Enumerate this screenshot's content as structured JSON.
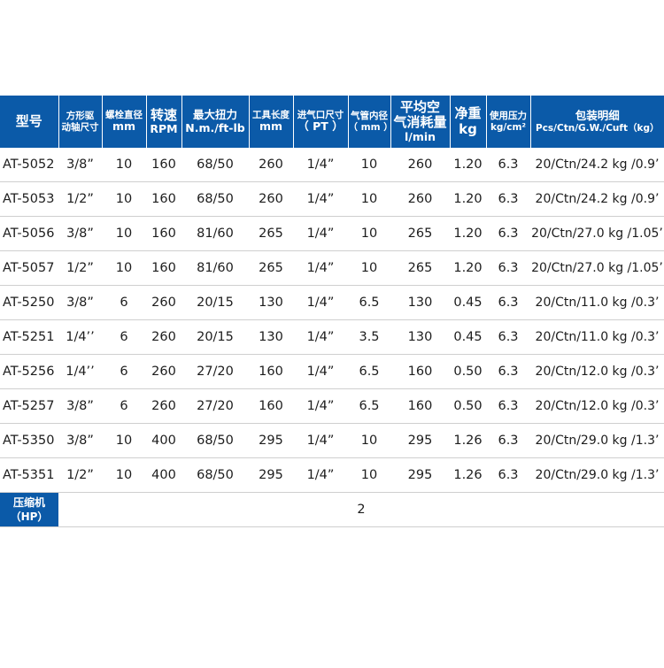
{
  "table": {
    "headers": [
      {
        "line1": "型号",
        "line2": ""
      },
      {
        "line1": "方形驱",
        "line2": "动轴尺寸"
      },
      {
        "line1": "螺栓直径",
        "line2": "mm"
      },
      {
        "line1": "转速",
        "line2": "RPM"
      },
      {
        "line1": "最大扭力",
        "line2": "N.m./ft-lb"
      },
      {
        "line1": "工具长度",
        "line2": "mm"
      },
      {
        "line1": "进气口尺寸",
        "line2": "（ PT ）"
      },
      {
        "line1": "气管内径",
        "line2": "（ mm ）"
      },
      {
        "line1": "平均空",
        "line2": "气消耗量",
        "line3": "l/min"
      },
      {
        "line1": "净重",
        "line2": "kg"
      },
      {
        "line1": "使用压力",
        "line2": "kg/cm²"
      },
      {
        "line1": "包装明细",
        "line2": "Pcs/Ctn/G.W./Cuft（kg）"
      }
    ],
    "rows": [
      [
        "AT-5052",
        "3/8”",
        "10",
        "160",
        "68/50",
        "260",
        "1/4”",
        "10",
        "260",
        "1.20",
        "6.3",
        "20/Ctn/24.2 kg /0.9’"
      ],
      [
        "AT-5053",
        "1/2”",
        "10",
        "160",
        "68/50",
        "260",
        "1/4”",
        "10",
        "260",
        "1.20",
        "6.3",
        "20/Ctn/24.2 kg /0.9’"
      ],
      [
        "AT-5056",
        "3/8”",
        "10",
        "160",
        "81/60",
        "265",
        "1/4”",
        "10",
        "265",
        "1.20",
        "6.3",
        "20/Ctn/27.0 kg /1.05’"
      ],
      [
        "AT-5057",
        "1/2”",
        "10",
        "160",
        "81/60",
        "265",
        "1/4”",
        "10",
        "265",
        "1.20",
        "6.3",
        "20/Ctn/27.0 kg /1.05’"
      ],
      [
        "AT-5250",
        "3/8”",
        "6",
        "260",
        "20/15",
        "130",
        "1/4”",
        "6.5",
        "130",
        "0.45",
        "6.3",
        "20/Ctn/11.0 kg /0.3’"
      ],
      [
        "AT-5251",
        "1/4’’",
        "6",
        "260",
        "20/15",
        "130",
        "1/4”",
        "3.5",
        "130",
        "0.45",
        "6.3",
        "20/Ctn/11.0 kg /0.3’"
      ],
      [
        "AT-5256",
        "1/4’’",
        "6",
        "260",
        "27/20",
        "160",
        "1/4”",
        "6.5",
        "160",
        "0.50",
        "6.3",
        "20/Ctn/12.0 kg /0.3’"
      ],
      [
        "AT-5257",
        "3/8”",
        "6",
        "260",
        "27/20",
        "160",
        "1/4”",
        "6.5",
        "160",
        "0.50",
        "6.3",
        "20/Ctn/12.0 kg /0.3’"
      ],
      [
        "AT-5350",
        "3/8”",
        "10",
        "400",
        "68/50",
        "295",
        "1/4”",
        "10",
        "295",
        "1.26",
        "6.3",
        "20/Ctn/29.0 kg /1.3’"
      ],
      [
        "AT-5351",
        "1/2”",
        "10",
        "400",
        "68/50",
        "295",
        "1/4”",
        "10",
        "295",
        "1.26",
        "6.3",
        "20/Ctn/29.0 kg /1.3’"
      ]
    ],
    "compressor": {
      "label_line1": "压缩机",
      "label_line2": "（HP）",
      "value": "2"
    }
  },
  "colors": {
    "header_bg": "#0b5aa8",
    "header_text": "#ffffff",
    "row_border": "#cfcfcf"
  }
}
